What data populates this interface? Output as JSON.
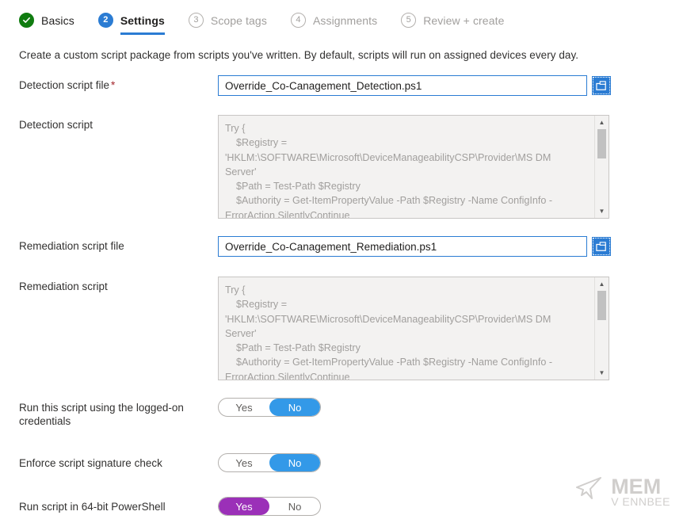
{
  "wizard": {
    "steps": [
      {
        "number": "",
        "label": "Basics",
        "state": "completed",
        "badge_icon": "check-icon"
      },
      {
        "number": "2",
        "label": "Settings",
        "state": "active",
        "badge_icon": ""
      },
      {
        "number": "3",
        "label": "Scope tags",
        "state": "disabled",
        "badge_icon": ""
      },
      {
        "number": "4",
        "label": "Assignments",
        "state": "disabled",
        "badge_icon": ""
      },
      {
        "number": "5",
        "label": "Review + create",
        "state": "disabled",
        "badge_icon": ""
      }
    ]
  },
  "description": "Create a custom script package from scripts you've written. By default, scripts will run on assigned devices every day.",
  "form": {
    "detection_script_file": {
      "label": "Detection script file",
      "required_marker": "*",
      "value": "Override_Co-Canagement_Detection.ps1",
      "browse_icon": "open-file-icon"
    },
    "detection_script": {
      "label": "Detection script",
      "value": "Try {\n    $Registry =\n'HKLM:\\SOFTWARE\\Microsoft\\DeviceManageabilityCSP\\Provider\\MS DM\nServer'\n    $Path = Test-Path $Registry\n    $Authority = Get-ItemPropertyValue -Path $Registry -Name ConfigInfo -\nErrorAction SilentlyContinue"
    },
    "remediation_script_file": {
      "label": "Remediation script file",
      "value": "Override_Co-Canagement_Remediation.ps1",
      "browse_icon": "open-file-icon"
    },
    "remediation_script": {
      "label": "Remediation script",
      "value": "Try {\n    $Registry =\n'HKLM:\\SOFTWARE\\Microsoft\\DeviceManageabilityCSP\\Provider\\MS DM\nServer'\n    $Path = Test-Path $Registry\n    $Authority = Get-ItemPropertyValue -Path $Registry -Name ConfigInfo -\nErrorAction SilentlyContinue"
    },
    "toggles": [
      {
        "label": "Run this script using the logged-on credentials",
        "yes_label": "Yes",
        "no_label": "No",
        "selected": "No",
        "accent": "#3399e8"
      },
      {
        "label": "Enforce script signature check",
        "yes_label": "Yes",
        "no_label": "No",
        "selected": "No",
        "accent": "#3399e8"
      },
      {
        "label": "Run script in 64-bit PowerShell",
        "yes_label": "Yes",
        "no_label": "No",
        "selected": "Yes",
        "accent": "#9b30b8"
      }
    ]
  },
  "watermark": {
    "title": "MEM",
    "subtitle": "V ENNBEE",
    "icon": "cursor-arrow-icon"
  },
  "colors": {
    "accent_blue": "#2b7cd3",
    "toggle_blue": "#3399e8",
    "toggle_purple": "#9b30b8",
    "success_green": "#107c10",
    "required_red": "#a4262c"
  }
}
